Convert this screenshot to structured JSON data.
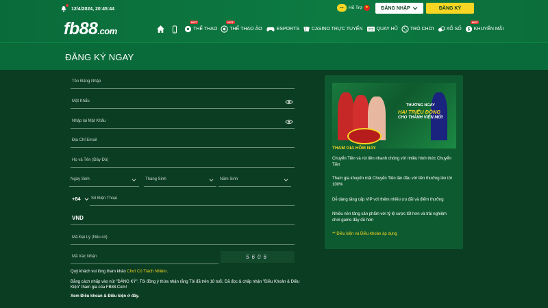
{
  "header": {
    "datetime": "12/4/2024, 20:45:44",
    "logo_main": "fb88",
    "logo_suffix": ".com",
    "support_label": "Hỗ Trợ",
    "login_button": "ĐĂNG NHẬP",
    "register_button": "ĐĂNG KÝ"
  },
  "nav": {
    "items": [
      {
        "label": "THỂ THAO",
        "icon": "soccer-ball-icon",
        "hot": "HOT"
      },
      {
        "label": "THỂ THAO ẢO",
        "icon": "virtual-sports-icon",
        "hot": "HOT"
      },
      {
        "label": "ESPORTS",
        "icon": "gamepad-icon"
      },
      {
        "label": "CASINO TRỰC TUYẾN",
        "icon": "cards-icon"
      },
      {
        "label": "QUAY HŨ",
        "icon": "slot-icon"
      },
      {
        "label": "TRÒ CHƠI",
        "icon": "dice-icon"
      },
      {
        "label": "XỔ SỐ",
        "icon": "lottery-icon"
      },
      {
        "label": "KHUYẾN MÃI",
        "icon": "gift-icon",
        "hot": "HOT"
      }
    ]
  },
  "page_title": "ĐĂNG KÝ NGAY",
  "form": {
    "username_ph": "Tên Đăng Nhập",
    "password_ph": "Mật Khẩu",
    "confirm_ph": "Nhập lại Mật Khẩu",
    "email_ph": "Địa Chỉ Email",
    "fullname_ph": "Họ và Tên (Đầy Đủ)",
    "dob_day": "Ngày Sinh",
    "dob_month": "Tháng Sinh",
    "dob_year": "Năm Sinh",
    "phone_code": "+84",
    "phone_ph": "Số Điện Thoại",
    "currency": "VND",
    "agent_ph": "Mã Đại Lý (Nếu có)",
    "captcha_ph": "Mã Xác Nhận",
    "captcha_code": "5606",
    "note1_pre": "Quý khách vui lòng tham khảo ",
    "note1_link": "Chơi Có Trách Nhiệm",
    "note1_post": ".",
    "note2": "Bằng cách nhấp vào nút \"ĐĂNG KÝ\". Tôi đồng ý thừa nhận rằng Tôi đã trên 18 tuổi, Đã đọc & chấp nhận \"Điều Khoản & Điều Kiện\" tham gia của FB88.Com!",
    "note3": "Xem Điều khoản & Điều kiện ở đây."
  },
  "promo": {
    "banner_line1": "THƯỞNG NGAY",
    "banner_line2": "HAI TRIỆU ĐỒNG",
    "banner_line3": "CHO THÀNH VIÊN MỚI",
    "heading": "THAM GIA HÔM NAY",
    "p1": "Chuyển Tiền và rút tiền nhanh chóng với nhiều hình thức Chuyển Tiền",
    "p2": "Tham gia khuyến mãi Chuyển Tiền lần đầu với tiền thưởng lên tới 100%",
    "p3": "Dễ dàng tăng cấp VIP với thêm nhiều ưu đãi và điểm thưởng",
    "p4": "Nhiều nền tảng sản phẩm với tỷ lệ cược tốt hơn và trải nghiệm chơi game đầy đủ hơn",
    "terms": "** Điều kiện và Điều khoản áp dụng"
  },
  "colors": {
    "brand_green": "#0a6b3a",
    "accent_yellow": "#f6d523",
    "background": "#0b3d22"
  }
}
